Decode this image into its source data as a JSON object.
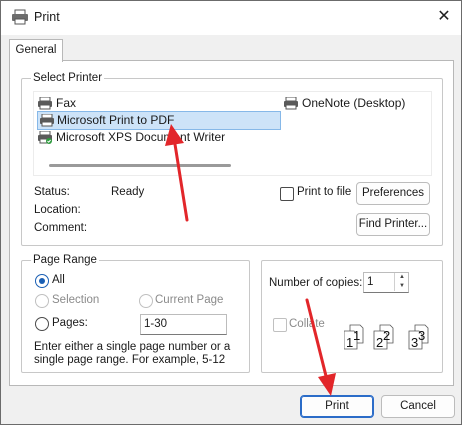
{
  "window": {
    "title": "Print",
    "close_symbol": "✕"
  },
  "tabs": [
    {
      "label": "General"
    }
  ],
  "select_printer": {
    "group_label": "Select Printer",
    "printers": [
      {
        "label": "Fax",
        "icon": "fax-icon"
      },
      {
        "label": "OneNote (Desktop)",
        "icon": "printer-icon"
      },
      {
        "label": "Microsoft Print to PDF",
        "icon": "printer-icon",
        "selected": true
      },
      {
        "label": "Microsoft XPS Document Writer",
        "icon": "printer-default-icon"
      }
    ],
    "status_label": "Status:",
    "status_value": "Ready",
    "location_label": "Location:",
    "comment_label": "Comment:",
    "print_to_file_label": "Print to file",
    "preferences_button": "Preferences",
    "find_printer_button": "Find Printer..."
  },
  "page_range": {
    "group_label": "Page Range",
    "all_label": "All",
    "selection_label": "Selection",
    "current_page_label": "Current Page",
    "pages_label": "Pages:",
    "pages_value": "1-30",
    "hint": "Enter either a single page number or a single page range.  For example, 5-12"
  },
  "copies": {
    "number_label": "Number of copies:",
    "number_value": "1",
    "collate_label": "Collate",
    "collate_digits": [
      "1",
      "1",
      "2",
      "2",
      "3",
      "3"
    ]
  },
  "footer": {
    "print_button": "Print",
    "cancel_button": "Cancel"
  },
  "colors": {
    "accent": "#1a5fb4",
    "selection_bg": "#cde3f8",
    "arrow": "#e2262a"
  }
}
